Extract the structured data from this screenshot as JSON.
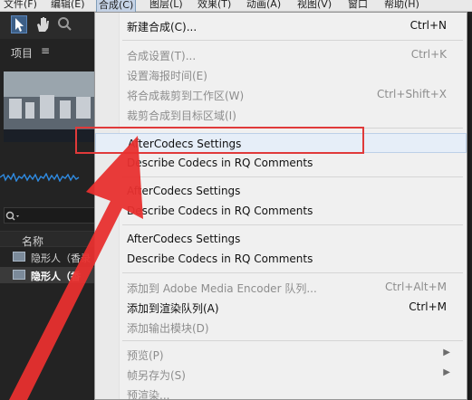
{
  "menubar": {
    "items": [
      {
        "label": "文件(F)"
      },
      {
        "label": "编辑(E)"
      },
      {
        "label": "合成(C)"
      },
      {
        "label": "图层(L)"
      },
      {
        "label": "效果(T)"
      },
      {
        "label": "动画(A)"
      },
      {
        "label": "视图(V)"
      },
      {
        "label": "窗口"
      },
      {
        "label": "帮助(H)"
      }
    ]
  },
  "project": {
    "title": "项目",
    "menu_icon": "≡",
    "column_name": "名称",
    "items": [
      {
        "label": "隐形人（香录"
      },
      {
        "label": "隐形人（香"
      }
    ]
  },
  "menu": {
    "items": [
      {
        "label": "新建合成(C)...",
        "shortcut": "Ctrl+N"
      },
      {
        "label": "合成设置(T)...",
        "shortcut": "Ctrl+K"
      },
      {
        "label": "设置海报时间(E)",
        "shortcut": ""
      },
      {
        "label": "将合成裁剪到工作区(W)",
        "shortcut": "Ctrl+Shift+X"
      },
      {
        "label": "裁剪合成到目标区域(I)",
        "shortcut": ""
      },
      {
        "label": "AfterCodecs Settings",
        "shortcut": ""
      },
      {
        "label": "Describe Codecs in RQ Comments",
        "shortcut": ""
      },
      {
        "label": "AfterCodecs Settings",
        "shortcut": ""
      },
      {
        "label": "Describe Codecs in RQ Comments",
        "shortcut": ""
      },
      {
        "label": "AfterCodecs Settings",
        "shortcut": ""
      },
      {
        "label": "Describe Codecs in RQ Comments",
        "shortcut": ""
      },
      {
        "label": "添加到 Adobe Media Encoder 队列...",
        "shortcut": "Ctrl+Alt+M"
      },
      {
        "label": "添加到渲染队列(A)",
        "shortcut": "Ctrl+M"
      },
      {
        "label": "添加输出模块(D)",
        "shortcut": ""
      },
      {
        "label": "预览(P)",
        "shortcut": ""
      },
      {
        "label": "帧另存为(S)",
        "shortcut": ""
      },
      {
        "label": "预渲染...",
        "shortcut": ""
      }
    ]
  },
  "colors": {
    "highlight_box": "#e03a3a",
    "arrow": "#e8302f",
    "menu_bg": "#f0f0f0",
    "panel_bg": "#232323"
  },
  "icons": [
    "selection-arrow-icon",
    "hand-icon",
    "zoom-icon",
    "search-icon",
    "footage-icon",
    "composition-icon",
    "submenu-arrow-icon"
  ]
}
